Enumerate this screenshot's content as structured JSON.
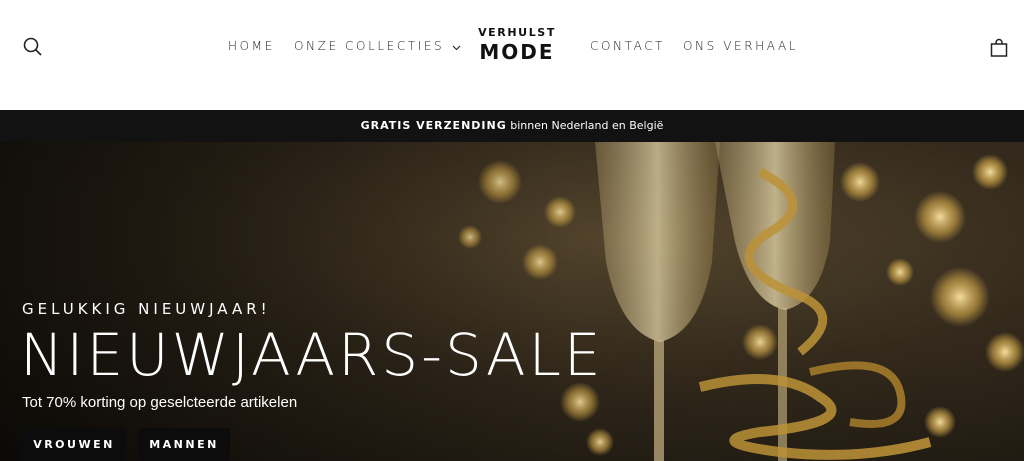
{
  "header": {
    "logo_line1": "VERHULST",
    "logo_line2": "MODE",
    "nav": [
      {
        "label": "HOME"
      },
      {
        "label": "ONZE COLLECTIES"
      },
      {
        "label": "CONTACT"
      },
      {
        "label": "ONS VERHAAL"
      }
    ]
  },
  "announcement": {
    "bold": "GRATIS VERZENDING",
    "rest": "binnen Nederland en België"
  },
  "hero": {
    "eyebrow": "GELUKKIG NIEUWJAAR!",
    "title": "NIEUWJAARS-SALE",
    "subtitle": "Tot 70% korting op geselcteerde artikelen",
    "buttons": [
      "VROUWEN",
      "MANNEN"
    ]
  },
  "colors": {
    "announcement_bg": "#121212",
    "button_bg": "#0c0c0c",
    "text_dark": "#222222"
  }
}
